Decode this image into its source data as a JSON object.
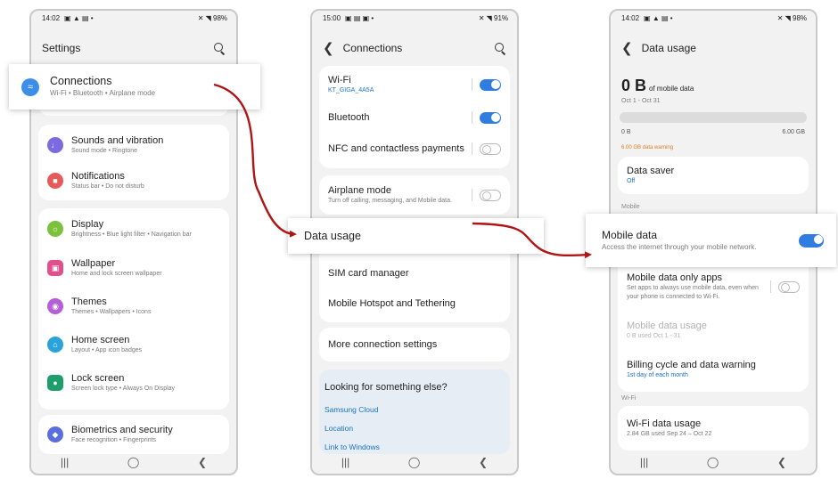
{
  "colors": {
    "accent": "#2f7de1",
    "arrow": "#b01515",
    "warning": "#e07b1f"
  },
  "phone1": {
    "status": {
      "time": "14:02",
      "left_icons": "▣ ▲ ▤ •",
      "right": "✕ ◥ 98%"
    },
    "title": "Settings",
    "connections": {
      "title": "Connections",
      "subtitle": "Wi-Fi  •  Bluetooth  •  Airplane mode"
    },
    "items": [
      {
        "title": "Sounds and vibration",
        "subtitle": "Sound mode  •  Ringtone",
        "icon": "speaker-icon",
        "color": "#7b6be0"
      },
      {
        "title": "Notifications",
        "subtitle": "Status bar  •  Do not disturb",
        "icon": "bell-icon",
        "color": "#e65a5a"
      },
      {
        "title": "Display",
        "subtitle": "Brightness  •  Blue light filter  •  Navigation bar",
        "icon": "sun-icon",
        "color": "#7cc13b"
      },
      {
        "title": "Wallpaper",
        "subtitle": "Home and lock screen wallpaper",
        "icon": "image-icon",
        "color": "#e0508b"
      },
      {
        "title": "Themes",
        "subtitle": "Themes  •  Wallpapers  •  Icons",
        "icon": "palette-icon",
        "color": "#b45fd6"
      },
      {
        "title": "Home screen",
        "subtitle": "Layout  •  App icon badges",
        "icon": "home-icon",
        "color": "#2aa3d9"
      },
      {
        "title": "Lock screen",
        "subtitle": "Screen lock type  •  Always On Display",
        "icon": "lock-icon",
        "color": "#1e9e6a"
      },
      {
        "title": "Biometrics and security",
        "subtitle": "Face recognition  •  Fingerprints",
        "icon": "shield-icon",
        "color": "#5a6ee0"
      }
    ]
  },
  "phone2": {
    "status": {
      "time": "15:00",
      "left_icons": "▣ ▤ ▣ •",
      "right": "✕ ◥ 91%"
    },
    "title": "Connections",
    "wifi": {
      "title": "Wi-Fi",
      "subtitle": "KT_GIGA_4A5A"
    },
    "bluetooth": {
      "title": "Bluetooth"
    },
    "nfc": {
      "title": "NFC and contactless payments"
    },
    "airplane": {
      "title": "Airplane mode",
      "subtitle": "Turn off calling, messaging, and Mobile data."
    },
    "data_usage": {
      "title": "Data usage"
    },
    "sim": {
      "title": "SIM card manager"
    },
    "hotspot": {
      "title": "Mobile Hotspot and Tethering"
    },
    "more": {
      "title": "More connection settings"
    },
    "looking": {
      "title": "Looking for something else?",
      "links": [
        "Samsung Cloud",
        "Location",
        "Link to Windows"
      ]
    }
  },
  "phone3": {
    "status": {
      "time": "14:02",
      "left_icons": "▣ ▲ ▤ •",
      "right": "✕ ◥ 98%"
    },
    "title": "Data usage",
    "amount": "0 B",
    "amount_suffix": "of mobile data",
    "period": "Oct 1 - Oct 31",
    "bar_min": "0 B",
    "bar_max": "6.00 GB",
    "bar_fill": 0,
    "warning": "6.00 GB data warning",
    "data_saver": {
      "title": "Data saver",
      "subtitle": "Off"
    },
    "section_mobile": "Mobile",
    "mobile_data": {
      "title": "Mobile data",
      "subtitle": "Access the internet through your mobile network."
    },
    "only_apps": {
      "title": "Mobile data only apps",
      "subtitle": "Set apps to always use mobile data, even when your phone is connected to Wi-Fi."
    },
    "mobile_usage": {
      "title": "Mobile data usage",
      "subtitle": "0 B used Oct 1 - 31"
    },
    "billing": {
      "title": "Billing cycle and data warning",
      "subtitle": "1st day of each month"
    },
    "section_wifi": "Wi-Fi",
    "wifi_usage": {
      "title": "Wi-Fi data usage",
      "subtitle": "2.84 GB used Sep 24 – Oct 22"
    }
  },
  "nav": {
    "recents": "|||",
    "home": "◯",
    "back": "❮"
  }
}
